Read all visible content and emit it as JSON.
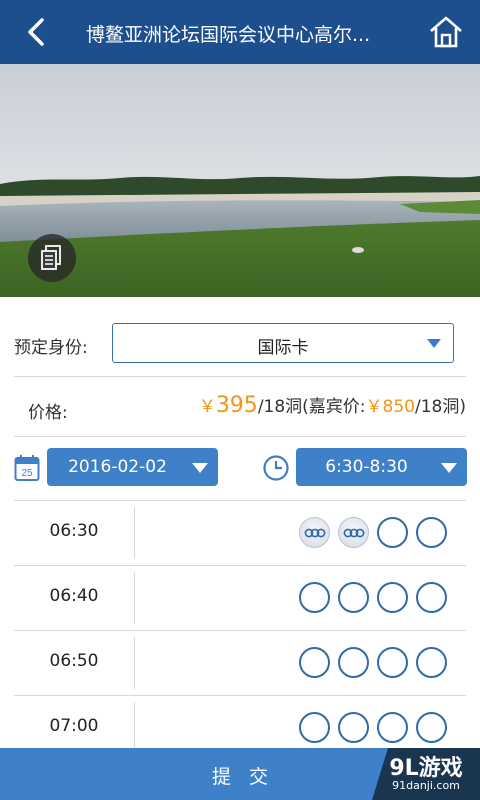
{
  "header": {
    "title": "博鳌亚洲论坛国际会议中心高尔...",
    "back_icon": "chevron-left-icon",
    "home_icon": "home-icon"
  },
  "hero": {
    "doc_icon": "document-icon"
  },
  "identity": {
    "label": "预定身份:",
    "selected": "国际卡"
  },
  "price": {
    "label": "价格:",
    "currency": "￥",
    "amount": "395",
    "unit": "/18洞(嘉宾价:",
    "guest_currency": "￥",
    "guest_amount": "850",
    "guest_unit": "/18洞)"
  },
  "date_picker": {
    "selected": "2016-02-02",
    "icon_day": "25"
  },
  "time_picker": {
    "selected": "6:30-8:30"
  },
  "slots": [
    {
      "time": "06:30",
      "booked": 2,
      "total": 4
    },
    {
      "time": "06:40",
      "booked": 0,
      "total": 4
    },
    {
      "time": "06:50",
      "booked": 0,
      "total": 4
    },
    {
      "time": "07:00",
      "booked": 0,
      "total": 4
    }
  ],
  "submit": {
    "label": "提交"
  },
  "watermark": {
    "text": "9L游戏",
    "sub": "91danji.com"
  },
  "colors": {
    "header": "#1d4f8f",
    "accent": "#3f81c8",
    "price": "#f39419"
  }
}
